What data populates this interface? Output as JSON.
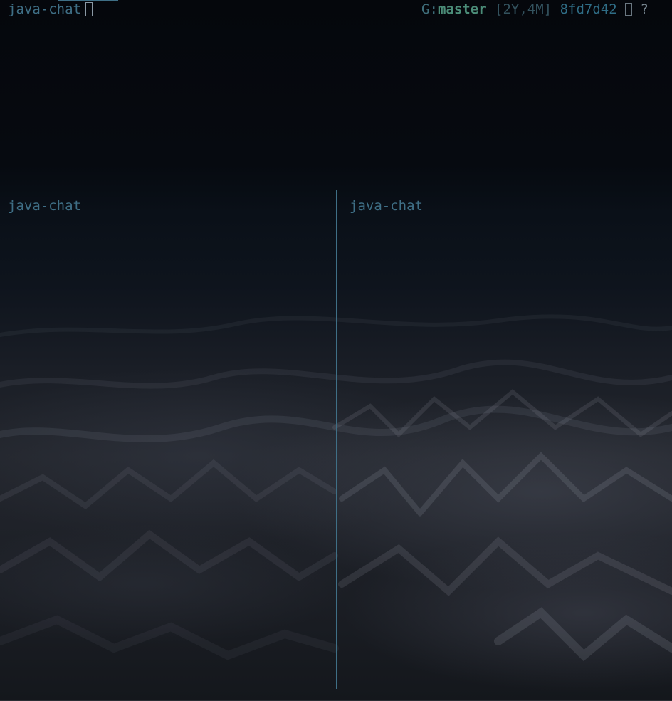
{
  "window": {
    "session_name": "java-chat",
    "cursor_glyph": "",
    "git": {
      "prefix": "G:",
      "branch": "master",
      "age": "[2Y,4M]",
      "hash": "8fd7d42",
      "status_glyph": "",
      "status_flag": "?"
    }
  },
  "panes": [
    {
      "title": "java-chat"
    },
    {
      "title": "java-chat"
    }
  ],
  "colors": {
    "active_border": "#b73838",
    "inactive_border": "#3f6f86",
    "text_accent": "#3f6f86",
    "branch": "#4b8c78"
  }
}
